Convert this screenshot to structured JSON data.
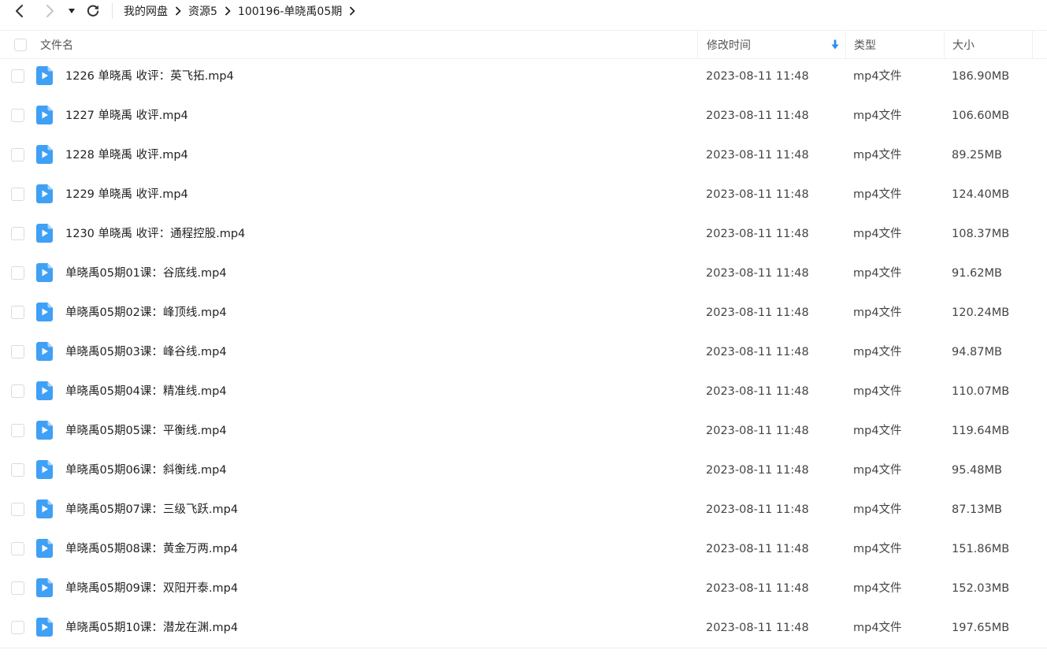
{
  "toolbar": {
    "back_icon": "chevron-left-icon",
    "forward_icon": "chevron-right-icon",
    "dropdown_icon": "caret-down-icon",
    "refresh_icon": "refresh-icon"
  },
  "breadcrumb": {
    "items": [
      "我的网盘",
      "资源5",
      "100196-单晓禹05期"
    ],
    "separator_icon": "chevron-right-icon"
  },
  "columns": {
    "name": "文件名",
    "time": "修改时间",
    "type": "类型",
    "size": "大小",
    "sort_icon": "sort-down-arrow-icon"
  },
  "colors": {
    "accent": "#3fa0f5",
    "sort_arrow": "#2d8cf0",
    "border": "#eef0f3"
  },
  "files": [
    {
      "name": "1226 单晓禹 收评：英飞拓.mp4",
      "time": "2023-08-11 11:48",
      "type": "mp4文件",
      "size": "186.90MB"
    },
    {
      "name": "1227 单晓禹 收评.mp4",
      "time": "2023-08-11 11:48",
      "type": "mp4文件",
      "size": "106.60MB"
    },
    {
      "name": "1228 单晓禹 收评.mp4",
      "time": "2023-08-11 11:48",
      "type": "mp4文件",
      "size": "89.25MB"
    },
    {
      "name": "1229 单晓禹 收评.mp4",
      "time": "2023-08-11 11:48",
      "type": "mp4文件",
      "size": "124.40MB"
    },
    {
      "name": "1230 单晓禹 收评：通程控股.mp4",
      "time": "2023-08-11 11:48",
      "type": "mp4文件",
      "size": "108.37MB"
    },
    {
      "name": "单晓禹05期01课：谷底线.mp4",
      "time": "2023-08-11 11:48",
      "type": "mp4文件",
      "size": "91.62MB"
    },
    {
      "name": "单晓禹05期02课：峰顶线.mp4",
      "time": "2023-08-11 11:48",
      "type": "mp4文件",
      "size": "120.24MB"
    },
    {
      "name": "单晓禹05期03课：峰谷线.mp4",
      "time": "2023-08-11 11:48",
      "type": "mp4文件",
      "size": "94.87MB"
    },
    {
      "name": "单晓禹05期04课：精准线.mp4",
      "time": "2023-08-11 11:48",
      "type": "mp4文件",
      "size": "110.07MB"
    },
    {
      "name": "单晓禹05期05课：平衡线.mp4",
      "time": "2023-08-11 11:48",
      "type": "mp4文件",
      "size": "119.64MB"
    },
    {
      "name": "单晓禹05期06课：斜衡线.mp4",
      "time": "2023-08-11 11:48",
      "type": "mp4文件",
      "size": "95.48MB"
    },
    {
      "name": "单晓禹05期07课：三级飞跃.mp4",
      "time": "2023-08-11 11:48",
      "type": "mp4文件",
      "size": "87.13MB"
    },
    {
      "name": "单晓禹05期08课：黄金万两.mp4",
      "time": "2023-08-11 11:48",
      "type": "mp4文件",
      "size": "151.86MB"
    },
    {
      "name": "单晓禹05期09课：双阳开泰.mp4",
      "time": "2023-08-11 11:48",
      "type": "mp4文件",
      "size": "152.03MB"
    },
    {
      "name": "单晓禹05期10课：潜龙在渊.mp4",
      "time": "2023-08-11 11:48",
      "type": "mp4文件",
      "size": "197.65MB"
    }
  ],
  "file_icon": "video-file-icon"
}
